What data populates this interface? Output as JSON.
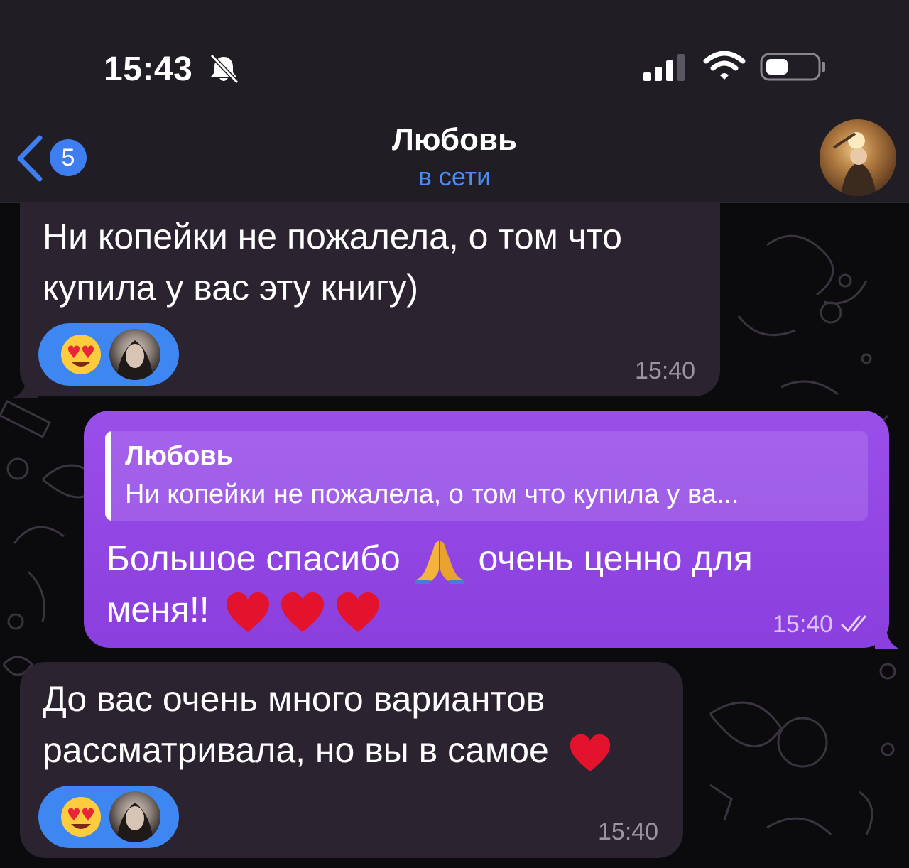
{
  "status_bar": {
    "time": "15:43",
    "icons": [
      "bell-slash-icon",
      "signal-icon",
      "wifi-icon",
      "battery-icon"
    ]
  },
  "header": {
    "unread_count": "5",
    "name": "Любовь",
    "status": "в сети",
    "back_icon": "chevron-left-icon"
  },
  "messages": [
    {
      "direction": "incoming",
      "lines": [
        "Ни копейки не пожалела, о том что",
        "купила у вас эту книгу)"
      ],
      "reaction": "heart-eyes-emoji",
      "time": "15:40"
    },
    {
      "direction": "outgoing",
      "reply": {
        "name": "Любовь",
        "text": "Ни копейки не пожалела, о том что купила у ва..."
      },
      "line1_a": "Большое спасибо",
      "line1_b": "очень ценно для",
      "line2": "меня!!",
      "emojis": [
        "praying-hands-emoji",
        "red-heart-emoji",
        "red-heart-emoji",
        "red-heart-emoji"
      ],
      "time": "15:40",
      "read_status": "double-check-icon"
    },
    {
      "direction": "incoming",
      "lines": [
        "До вас очень много вариантов",
        "рассматривала, но вы в самое"
      ],
      "reaction": "heart-eyes-emoji",
      "time": "15:40"
    }
  ],
  "colors": {
    "header_bg": "#211d24",
    "incoming_bubble": "#2b2430",
    "outgoing_bubble": "#8f43e2",
    "accent_blue": "#3e86f2",
    "status_blue": "#4c8cf5"
  }
}
